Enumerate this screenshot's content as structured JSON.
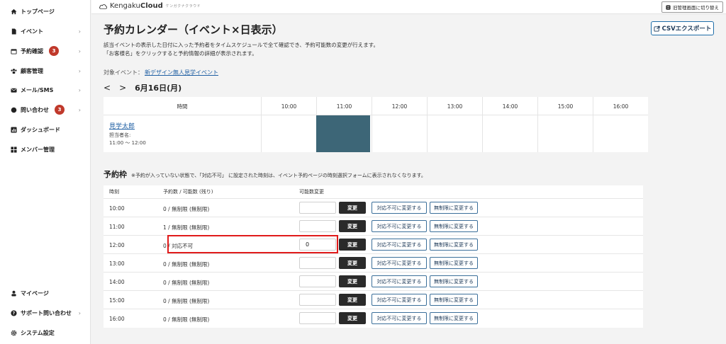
{
  "sidebar": {
    "items": [
      {
        "label": "トップページ",
        "icon": "home-icon"
      },
      {
        "label": "イベント",
        "icon": "document-icon"
      },
      {
        "label": "予約確認",
        "icon": "calendar-icon",
        "badge": "3"
      },
      {
        "label": "顧客管理",
        "icon": "users-icon"
      },
      {
        "label": "メール/SMS",
        "icon": "mail-icon"
      },
      {
        "label": "問い合わせ",
        "icon": "chat-icon",
        "badge": "3"
      },
      {
        "label": "ダッシュボード",
        "icon": "chart-icon"
      },
      {
        "label": "メンバー管理",
        "icon": "grid-icon"
      }
    ],
    "bottom_items": [
      {
        "label": "マイページ",
        "icon": "person-icon"
      },
      {
        "label": "サポート問い合わせ",
        "icon": "help-icon"
      },
      {
        "label": "システム設定",
        "icon": "gear-icon"
      }
    ]
  },
  "topbar": {
    "brand_light": "Kengaku",
    "brand_bold": "Cloud",
    "brand_sub": "ケンガクナクラウド",
    "switch_label": "旧管理画面に切り替え"
  },
  "page": {
    "title": "予約カレンダー（イベント×日表示）",
    "desc1": "該当イベントの表示した日付に入った予約者をタイムスケジュールで全て確認でき、予約可能数の変更が行えます。",
    "desc2": "「お客様名」をクリックすると予約情報の詳細が表示されます。",
    "csv_label": "CSVエクスポート",
    "target_label": "対象イベント：",
    "target_event": "新デザイン無人見学イベント",
    "prev": "<",
    "next": ">",
    "date": "6月16日(月)"
  },
  "calendar": {
    "header_time": "時間",
    "hours": [
      "10:00",
      "11:00",
      "12:00",
      "13:00",
      "14:00",
      "15:00",
      "16:00"
    ],
    "booking": {
      "name": "見学太郎",
      "staff": "担当者名:",
      "time": "11:00 〜 12:00"
    }
  },
  "slots": {
    "title": "予約枠",
    "note": "※予約が入っていない状態で、「対応不可」 に設定された時刻は、イベント予約ページの時刻選択フォームに表示されなくなります。",
    "col_time": "時刻",
    "col_count": "予約数 / 可能数 (残り)",
    "col_change": "可能数変更",
    "change_label": "変更",
    "unavailable_label": "対応不可に変更する",
    "unlimited_label": "無制限に変更する",
    "rows": [
      {
        "time": "10:00",
        "count": "0 / 無制限 (無制限)",
        "input": ""
      },
      {
        "time": "11:00",
        "count": "1 / 無制限 (無制限)",
        "input": ""
      },
      {
        "time": "12:00",
        "count": "0 / 対応不可",
        "input": "0"
      },
      {
        "time": "13:00",
        "count": "0 / 無制限 (無制限)",
        "input": ""
      },
      {
        "time": "14:00",
        "count": "0 / 無制限 (無制限)",
        "input": ""
      },
      {
        "time": "15:00",
        "count": "0 / 無制限 (無制限)",
        "input": ""
      },
      {
        "time": "16:00",
        "count": "0 / 無制限 (無制限)",
        "input": ""
      }
    ]
  },
  "colors": {
    "booking_block": "#3d6677",
    "highlight": "#e01a1a",
    "badge": "#c0392b"
  }
}
